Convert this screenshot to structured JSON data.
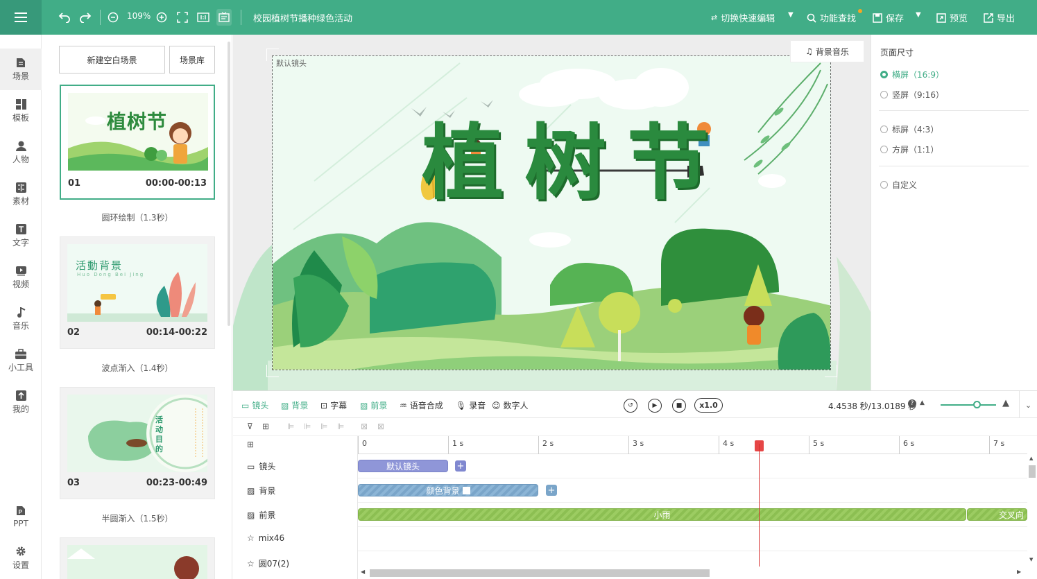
{
  "topbar": {
    "zoom": "109%",
    "project_title": "校园植树节播种绿色活动",
    "quick_edit": "切换快速编辑",
    "feature_search": "功能查找",
    "save": "保存",
    "preview": "预览",
    "export": "导出",
    "accent": "#41ad87"
  },
  "rail": {
    "items": [
      {
        "label": "场景",
        "icon": "scene-icon"
      },
      {
        "label": "模板",
        "icon": "template-icon"
      },
      {
        "label": "人物",
        "icon": "person-icon"
      },
      {
        "label": "素材",
        "icon": "material-icon"
      },
      {
        "label": "文字",
        "icon": "text-icon"
      },
      {
        "label": "视频",
        "icon": "video-icon"
      },
      {
        "label": "音乐",
        "icon": "music-icon"
      },
      {
        "label": "小工具",
        "icon": "toolbox-icon"
      },
      {
        "label": "我的",
        "icon": "upload-icon"
      }
    ],
    "ppt": "PPT",
    "settings": "设置"
  },
  "scenes": {
    "new_blank": "新建空白场景",
    "library": "场景库",
    "cards": [
      {
        "num": "01",
        "time": "00:00-00:13",
        "caption": "圆环绘制（1.3秒）",
        "thumb_title": "植树节"
      },
      {
        "num": "02",
        "time": "00:14-00:22",
        "caption": "波点渐入（1.4秒）",
        "thumb_title": "活動背景",
        "thumb_sub": "Huo Dong Bei Jing"
      },
      {
        "num": "03",
        "time": "00:23-00:49",
        "caption": "半圆渐入（1.5秒）",
        "thumb_title": "活动目的"
      }
    ]
  },
  "canvas": {
    "label": "默认镜头",
    "bgm": "背景音乐",
    "title": "植树节"
  },
  "page_size": {
    "heading": "页面尺寸",
    "options": [
      {
        "label": "横屏（16:9）",
        "selected": true
      },
      {
        "label": "竖屏（9:16）",
        "selected": false
      },
      {
        "label": "标屏（4:3）",
        "selected": false
      },
      {
        "label": "方屏（1:1）",
        "selected": false
      },
      {
        "label": "自定义",
        "selected": false
      }
    ]
  },
  "timeline": {
    "tools": [
      "镜头",
      "背景",
      "字幕",
      "前景",
      "语音合成",
      "录音",
      "数字人"
    ],
    "speed": "x1.0",
    "time": "4.4538 秒/13.0189 秒",
    "ruler": [
      "0",
      "1 s",
      "2 s",
      "3 s",
      "4 s",
      "5 s",
      "6 s",
      "7 s"
    ],
    "tracks": [
      {
        "label": "镜头",
        "icon": "camera-icon"
      },
      {
        "label": "背景",
        "icon": "background-icon"
      },
      {
        "label": "前景",
        "icon": "foreground-icon"
      },
      {
        "label": "mix46",
        "icon": "star-icon"
      },
      {
        "label": "圆07(2)",
        "icon": "star-icon"
      }
    ],
    "clips": {
      "camera": "默认镜头",
      "background": "颜色背景",
      "foreground_1": "小雨",
      "foreground_2": "交叉向"
    },
    "playhead_seconds": 4.4538,
    "total_seconds": 13.0189
  }
}
